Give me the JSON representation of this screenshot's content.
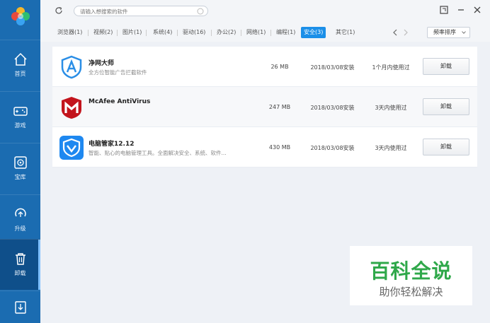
{
  "sidebar": {
    "items": [
      {
        "label": "首页",
        "icon": "home-icon"
      },
      {
        "label": "游戏",
        "icon": "gamepad-icon"
      },
      {
        "label": "宝库",
        "icon": "treasure-icon"
      },
      {
        "label": "升级",
        "icon": "upgrade-icon"
      },
      {
        "label": "卸载",
        "icon": "trash-icon"
      },
      {
        "label": "",
        "icon": "download-icon"
      }
    ],
    "active": "卸载"
  },
  "topbar": {
    "search_placeholder": "请输入想搜索的软件"
  },
  "tabs": [
    "浏览器(1)",
    "视频(2)",
    "图片(1)",
    "系统(4)",
    "驱动(16)",
    "办公(2)",
    "网络(1)",
    "编程(1)",
    "安全(3)",
    "其它(1)"
  ],
  "active_tab": "安全(3)",
  "sort_label": "频率排序",
  "apps": [
    {
      "name": "净网大师",
      "desc": "全方位智能广告拦截软件",
      "size": "26 MB",
      "date": "2018/03/08安装",
      "usage": "1个月内使用过",
      "action": "卸载"
    },
    {
      "name": "McAfee AntiVirus",
      "desc": "",
      "size": "247 MB",
      "date": "2018/03/08安装",
      "usage": "3天内使用过",
      "action": "卸载"
    },
    {
      "name": "电脑管家12.12",
      "desc": "智能、贴心的电脑管理工具。全面解决安全、系统、软件...",
      "size": "430 MB",
      "date": "2018/03/08安装",
      "usage": "3天内使用过",
      "action": "卸载"
    }
  ],
  "watermark": {
    "title": "百科全说",
    "subtitle": "助你轻松解决"
  },
  "colors": {
    "sidebar": "#1b6cb1",
    "accent": "#1b8fe8",
    "watermark_green": "#2fa84a"
  }
}
